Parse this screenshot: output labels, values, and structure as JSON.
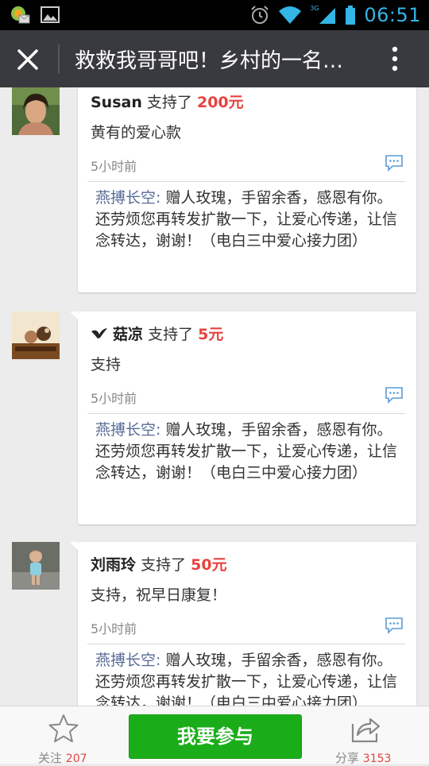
{
  "status_bar": {
    "time": "06:51",
    "network_label": "3G"
  },
  "title_bar": {
    "title": "救救我哥哥吧！乡村的一名…"
  },
  "donations": [
    {
      "name": "Susan",
      "supported_text": "支持了",
      "amount": "200元",
      "message": "黄有的爱心款",
      "time": "5小时前",
      "reply_name": "燕搏长空:",
      "reply_text": "赠人玫瑰，手留余香，感恩有你。还劳烦您再转发扩散一下，让爱心传递，让信念转达，谢谢！（电白三中爱心接力团）"
    },
    {
      "name": "菇凉",
      "supported_text": "支持了",
      "amount": "5元",
      "message": "支持",
      "time": "5小时前",
      "reply_name": "燕搏长空:",
      "reply_text": "赠人玫瑰，手留余香，感恩有你。还劳烦您再转发扩散一下，让爱心传递，让信念转达，谢谢！（电白三中爱心接力团）"
    },
    {
      "name": "刘雨玲",
      "supported_text": "支持了",
      "amount": "50元",
      "message": "支持，祝早日康复！",
      "time": "5小时前",
      "reply_name": "燕搏长空:",
      "reply_text": "赠人玫瑰，手留余香，感恩有你。还劳烦您再转发扩散一下，让爱心传递，让信念转达，谢谢！（电白三中爱心接力团）"
    }
  ],
  "bottom_bar": {
    "follow_label": "关注",
    "follow_count": "207",
    "join_label": "我要参与",
    "share_label": "分享",
    "share_count": "3153"
  },
  "colors": {
    "accent_green": "#1aad19",
    "amount_red": "#e64340",
    "link_blue": "#576b95",
    "titlebar": "#393a3f"
  }
}
